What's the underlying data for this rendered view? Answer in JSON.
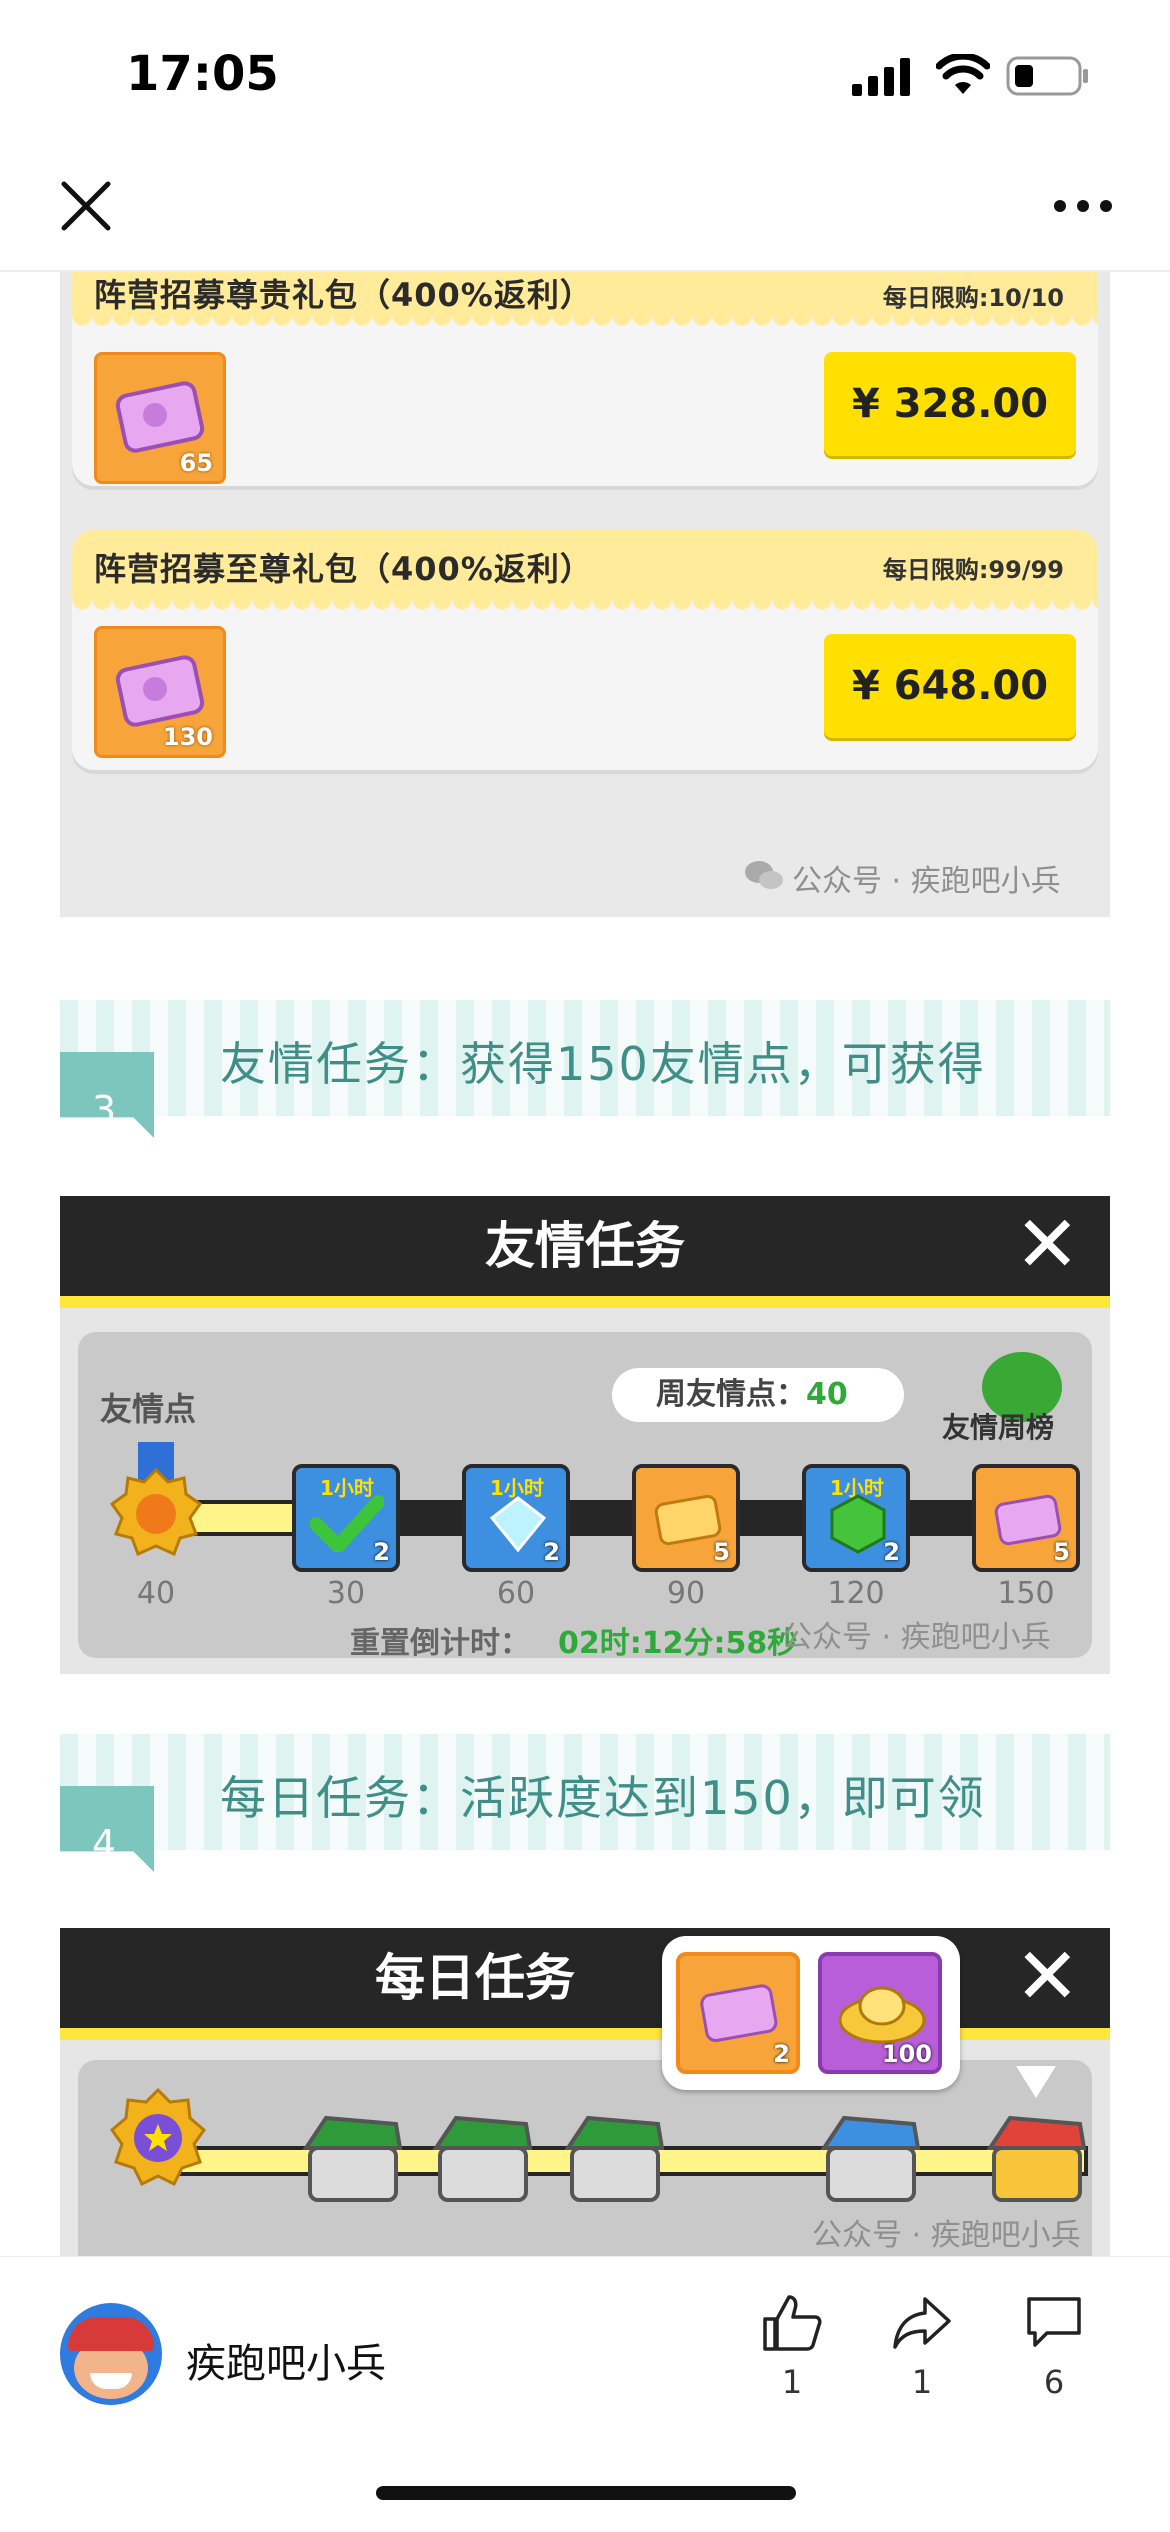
{
  "status_bar": {
    "time": "17:05"
  },
  "nav": {
    "close_icon": "close-icon",
    "more_icon": "more-dots-icon"
  },
  "shop": {
    "packs": [
      {
        "name": "阵营招募尊贵礼包（400%返利）",
        "limit": "每日限购:10/10",
        "count": "65",
        "price": "¥ 328.00"
      },
      {
        "name": "阵营招募至尊礼包（400%返利）",
        "limit": "每日限购:99/99",
        "count": "130",
        "price": "¥ 648.00"
      }
    ],
    "watermark": "公众号 · 疾跑吧小兵"
  },
  "section3": {
    "number": "3",
    "text": "友情任务：获得150友情点，可获得"
  },
  "friendship": {
    "title": "友情任务",
    "points_label": "友情点",
    "weekly_label": "周友情点：",
    "weekly_value": "40",
    "rank_label": "友情周榜",
    "current_value": "40",
    "rewards": [
      {
        "label": "30",
        "count": "2",
        "tag": "1小时",
        "kind": "check",
        "claimed": true
      },
      {
        "label": "60",
        "count": "2",
        "tag": "1小时",
        "kind": "diamond",
        "claimed": false
      },
      {
        "label": "90",
        "count": "5",
        "tag": "",
        "kind": "gold-ticket",
        "claimed": false
      },
      {
        "label": "120",
        "count": "2",
        "tag": "1小时",
        "kind": "green-gem",
        "claimed": false
      },
      {
        "label": "150",
        "count": "5",
        "tag": "",
        "kind": "purple-ticket",
        "claimed": false
      }
    ],
    "reset_label": "重置倒计时：",
    "reset_value": "02时:12分:58秒",
    "watermark": "公众号 · 疾跑吧小兵"
  },
  "section4": {
    "number": "4",
    "text": "每日任务：活跃度达到150，即可领"
  },
  "daily": {
    "title": "每日任务",
    "popup_rewards": [
      {
        "kind": "purple-ticket",
        "count": "2"
      },
      {
        "kind": "gold-ingot",
        "count": "100"
      }
    ],
    "watermark": "公众号 · 疾跑吧小兵"
  },
  "bottom": {
    "account": "疾跑吧小兵",
    "like_count": "1",
    "share_count": "1",
    "comment_count": "6"
  },
  "colors": {
    "accent_yellow": "#ffe000",
    "green": "#3aa835",
    "teal": "#7cc6bd",
    "dark": "#262626"
  }
}
